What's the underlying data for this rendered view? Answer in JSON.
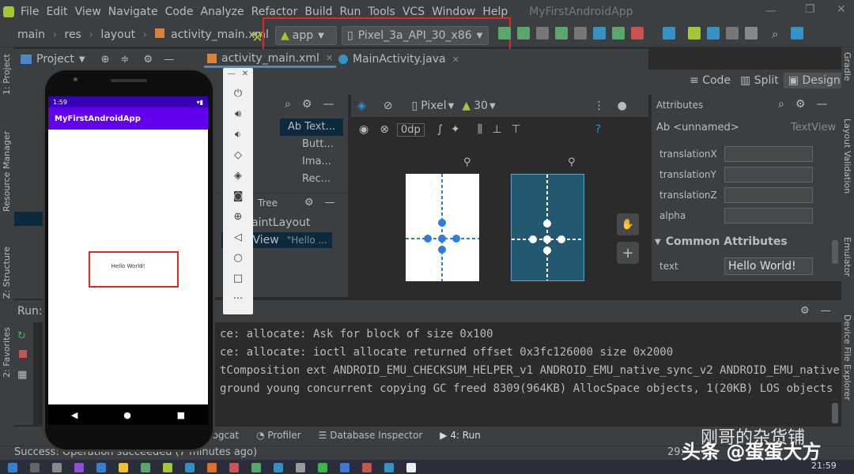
{
  "menu": [
    "File",
    "Edit",
    "View",
    "Navigate",
    "Code",
    "Analyze",
    "Refactor",
    "Build",
    "Run",
    "Tools",
    "VCS",
    "Window",
    "Help"
  ],
  "window_title": "MyFirstAndroidApp",
  "breadcrumb": [
    "main",
    "res",
    "layout",
    "activity_main.xml"
  ],
  "run_config": {
    "module": "app",
    "device": "Pixel_3a_API_30_x86"
  },
  "project_panel": {
    "label": "Project"
  },
  "editor_tabs": [
    "activity_main.xml",
    "MainActivity.java"
  ],
  "view_modes": [
    "Code",
    "Split",
    "Design"
  ],
  "palette_items": [
    "Ab Text...",
    "Butt...",
    "Ima...",
    "Rec..."
  ],
  "design_toolbar": {
    "device": "Pixel",
    "api": "30",
    "margin": "0dp"
  },
  "component_tree": {
    "label": "Tree",
    "items": [
      "aintLayout",
      "tView"
    ],
    "hint": "\"Hello ..."
  },
  "attributes": {
    "title": "Attributes",
    "component": "Ab <unnamed>",
    "component_type": "TextView",
    "rows": [
      "translationX",
      "translationY",
      "translationZ",
      "alpha"
    ],
    "section": "Common Attributes",
    "text_label": "text",
    "text_value": "Hello World!"
  },
  "log_lines": [
    "ce: allocate: Ask for block of size 0x100",
    "ce: allocate: ioctl allocate returned offset 0x3fc126000 size 0x2000",
    "tComposition ext ANDROID_EMU_CHECKSUM_HELPER_v1 ANDROID_EMU_native_sync_v2 ANDROID_EMU_native",
    "ground young concurrent copying GC freed 8309(964KB) AllocSpace objects, 1(20KB) LOS objects"
  ],
  "run_label": "Run:",
  "bottom_tabs": [
    "Logcat",
    "Profiler",
    "Database Inspector",
    "4: Run"
  ],
  "status": "Success: Operation succeeded (7 minutes ago)",
  "status_pos": "29:",
  "phone": {
    "time": "1:59",
    "app_title": "MyFirstAndroidApp",
    "content": "Hello World!"
  },
  "left_vtabs": [
    "1: Project",
    "Resource Manager",
    "Z: Structure",
    "2: Favorites"
  ],
  "right_vtabs": [
    "Gradle",
    "Layout Validation",
    "Emulator",
    "Device File Explorer"
  ],
  "watermark": "头条 @蛋蛋大方",
  "watermark2": "刚哥的杂货铺",
  "clock": "21:59",
  "colors": {
    "accent": "#4a88c7",
    "android_green": "#a4c639",
    "red": "#e0281e",
    "purple": "#6200ee",
    "blueprint": "#235870"
  }
}
